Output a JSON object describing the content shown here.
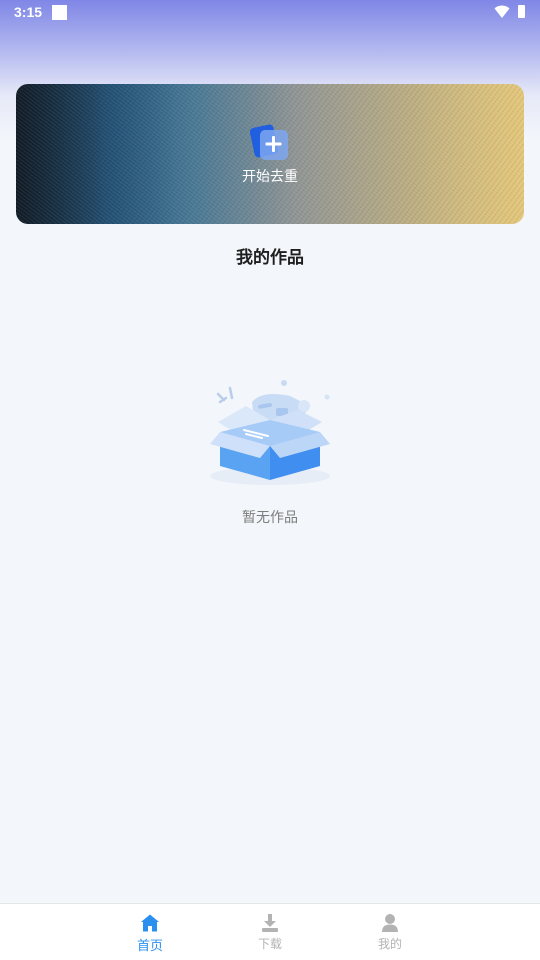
{
  "status_bar": {
    "time": "3:15"
  },
  "banner": {
    "action_label": "开始去重",
    "icon": "add-video-icon"
  },
  "works": {
    "title": "我的作品",
    "empty_text": "暂无作品",
    "empty_icon": "empty-box-icon"
  },
  "bottom_nav": {
    "items": [
      {
        "label": "首页",
        "icon": "home-icon",
        "active": true
      },
      {
        "label": "下载",
        "icon": "download-icon",
        "active": false
      },
      {
        "label": "我的",
        "icon": "user-icon",
        "active": false
      }
    ]
  },
  "colors": {
    "accent": "#2b8ff0",
    "inactive": "#b3b3b3",
    "background": "#f3f6fa",
    "header_gradient_top": "#7f86e6"
  }
}
